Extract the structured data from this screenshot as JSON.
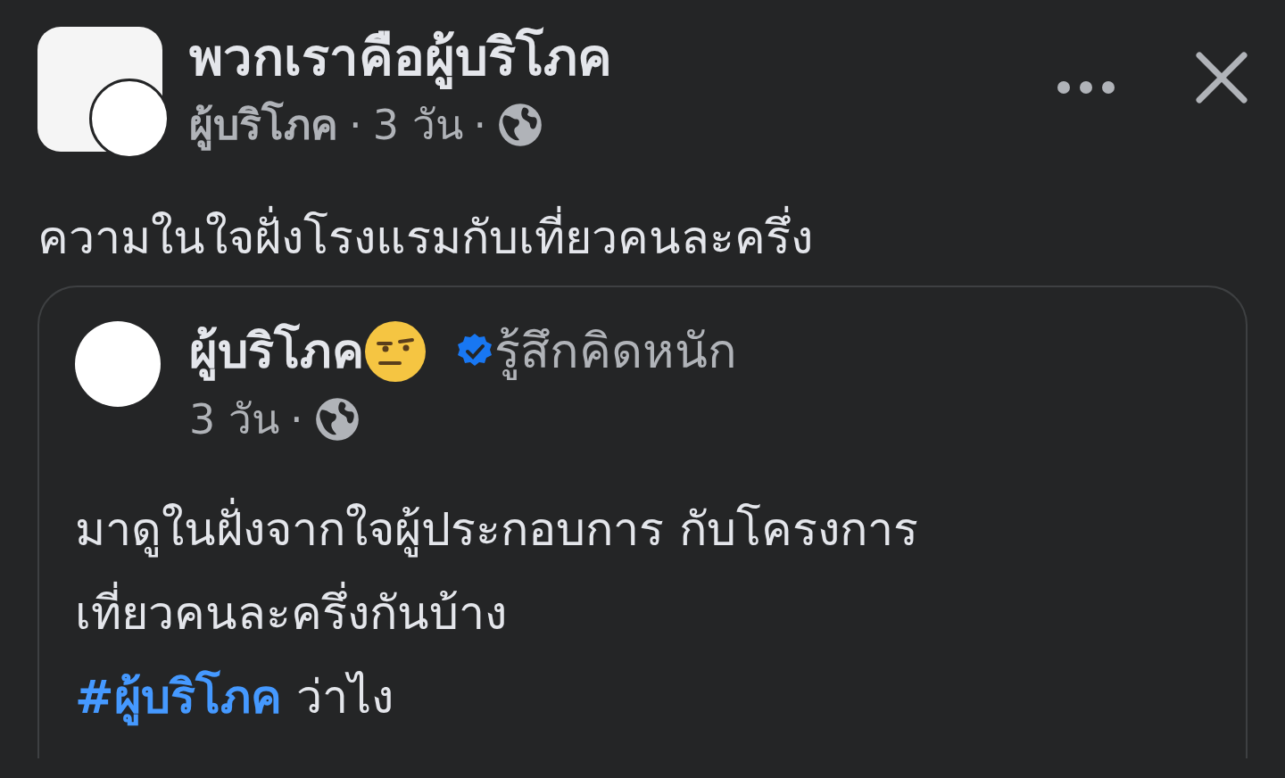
{
  "post": {
    "group_name": "พวกเราคือผู้บริโภค",
    "author": "ผู้บริโภค",
    "separators": [
      "·",
      "·"
    ],
    "time": "3 วัน",
    "text": "ความในใจฝั่งโรงแรมกับเที่ยวคนละครึ่ง"
  },
  "shared_post": {
    "author": "ผู้บริโภค",
    "feeling": "รู้สึกคิดหนัก",
    "verified": true,
    "time": "3 วัน",
    "separator": "·",
    "text_lines": [
      "มาดูในฝั่งจากใจผู้ประกอบการ กับโครงการ",
      "เที่ยวคนละครึ่งกันบ้าง"
    ],
    "hashtag": "#ผู้บริโภค",
    "hashtag_suffix": "ว่าไง"
  }
}
